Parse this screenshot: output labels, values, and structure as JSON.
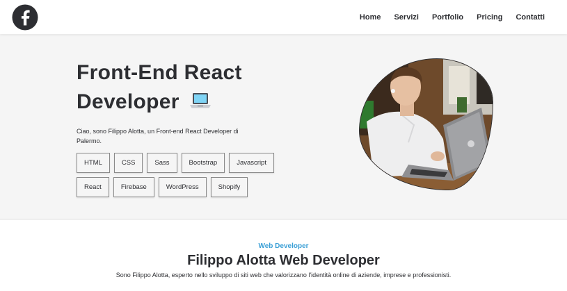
{
  "header": {
    "logo_icon": "f-logo-icon",
    "nav": [
      "Home",
      "Servizi",
      "Portfolio",
      "Pricing",
      "Contatti"
    ]
  },
  "hero": {
    "title_line1": "Front-End React",
    "title_line2": "Developer",
    "title_icon": "laptop-icon",
    "intro": "Ciao, sono Filippo Alotta, un Front-end React Developer di Palermo.",
    "skills": [
      "HTML",
      "CSS",
      "Sass",
      "Bootstrap",
      "Javascript",
      "React",
      "Firebase",
      "WordPress",
      "Shopify"
    ],
    "photo": "portrait-photo"
  },
  "about": {
    "eyebrow": "Web Developer",
    "title": "Filippo Alotta Web Developer",
    "description": "Sono Filippo Alotta, esperto nello sviluppo di siti web che valorizzano l'identità online di aziende, imprese e professionisti."
  },
  "colors": {
    "text": "#2d2e32",
    "hero_bg": "#f5f5f5",
    "accent": "#3a9fd6",
    "header_bg": "#ffffff"
  }
}
